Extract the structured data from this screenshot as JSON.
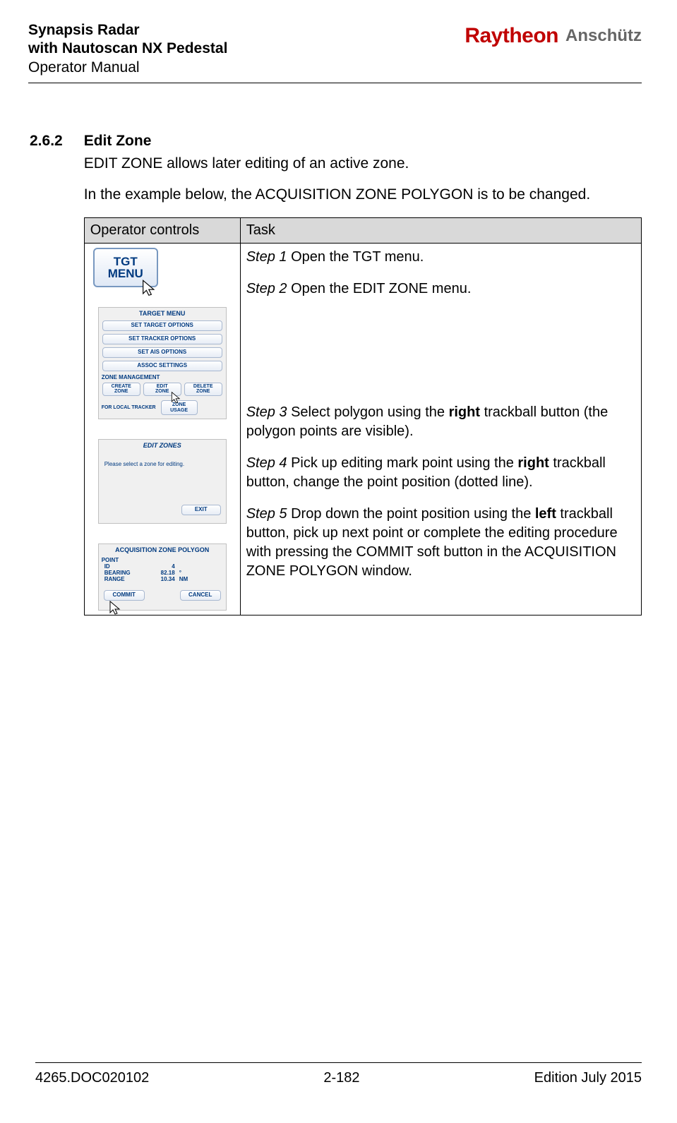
{
  "header": {
    "title_line1": "Synapsis Radar",
    "title_line2": "with Nautoscan NX Pedestal",
    "subtitle": "Operator Manual",
    "brand1": "Raytheon",
    "brand2": "Anschütz"
  },
  "section": {
    "number": "2.6.2",
    "title": "Edit Zone",
    "para1": "EDIT ZONE allows later editing of an active zone.",
    "para2": "In the example below, the ACQUISITION ZONE POLYGON is to be changed."
  },
  "table": {
    "header_op": "Operator controls",
    "header_task": "Task",
    "steps": {
      "s1_prefix": "Step 1",
      "s1_text": " Open the TGT menu.",
      "s2_prefix": "Step 2",
      "s2_text": " Open the EDIT ZONE menu.",
      "s3_prefix": "Step 3",
      "s3_text_a": " Select polygon using the ",
      "s3_bold": "right",
      "s3_text_b": " trackball button (the polygon points are visible).",
      "s4_prefix": "Step 4",
      "s4_text_a": " Pick up editing mark point using the ",
      "s4_bold": "right",
      "s4_text_b": " trackball button, change the point position (dotted line).",
      "s5_prefix": "Step 5",
      "s5_text_a": " Drop down the point position using the ",
      "s5_bold": "left",
      "s5_text_b": " trackball button, pick up next point or complete the editing procedure with pressing the COMMIT soft button in the ACQUISITION ZONE POLYGON window."
    },
    "op": {
      "tgt_line1": "TGT",
      "tgt_line2": "MENU",
      "target_menu_title": "TARGET MENU",
      "btn_set_target": "SET TARGET OPTIONS",
      "btn_set_tracker": "SET TRACKER OPTIONS",
      "btn_set_ais": "SET AIS OPTIONS",
      "btn_assoc": "ASSOC SETTINGS",
      "zone_mgmt": "ZONE MANAGEMENT",
      "create_zone_l1": "CREATE",
      "create_zone_l2": "ZONE",
      "edit_zone_l1": "EDIT",
      "edit_zone_l2": "ZONE",
      "delete_zone_l1": "DELETE",
      "delete_zone_l2": "ZONE",
      "for_local": "FOR LOCAL TRACKER",
      "zone_usage_l1": "ZONE",
      "zone_usage_l2": "USAGE",
      "edit_zones_title": "EDIT ZONES",
      "edit_zones_msg": "Please select a zone for editing.",
      "exit_btn": "EXIT",
      "acq_title": "ACQUISITION ZONE POLYGON",
      "point_label": "POINT",
      "id_label": "ID",
      "id_value": "4",
      "bearing_label": "BEARING",
      "bearing_value": "82.18",
      "bearing_unit": "°",
      "range_label": "RANGE",
      "range_value": "10.34",
      "range_unit": "NM",
      "commit_btn": "COMMIT",
      "cancel_btn": "CANCEL"
    }
  },
  "footer": {
    "left": "4265.DOC020102",
    "center": "2-182",
    "right": "Edition July 2015"
  }
}
